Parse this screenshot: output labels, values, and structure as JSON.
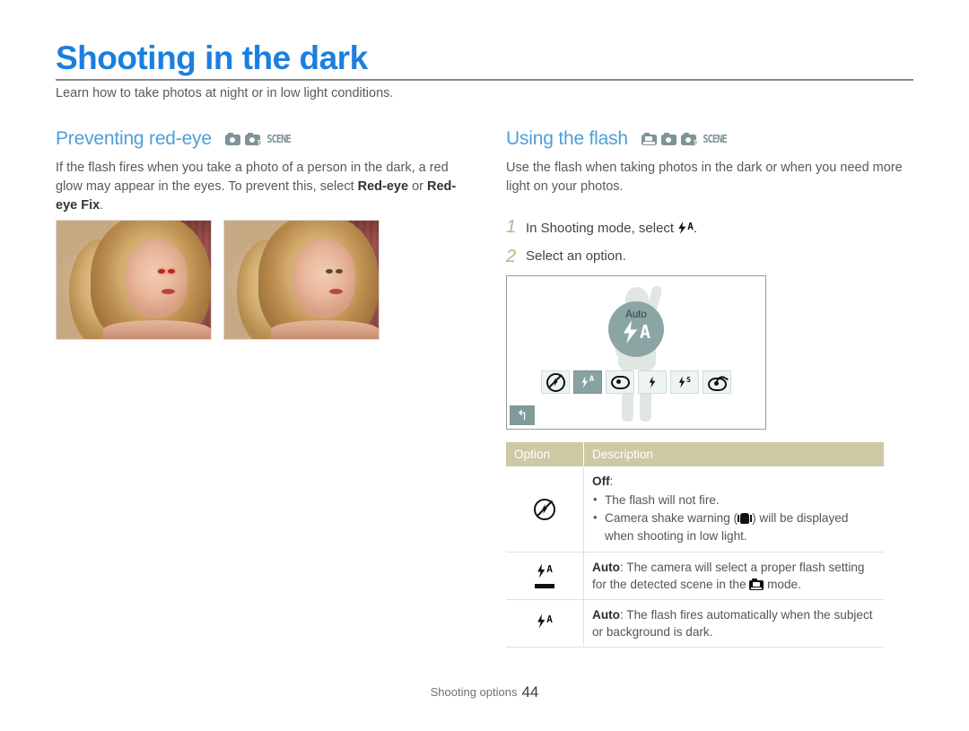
{
  "page": {
    "title": "Shooting in the dark",
    "subtitle": "Learn how to take photos at night or in low light conditions.",
    "footer_label": "Shooting options",
    "footer_page": "44",
    "accent_color": "#1b7fe0",
    "heading_color": "#4d9fd8",
    "rule_color": "#8e867c",
    "table_header_color": "#cdc9a5",
    "step_number_color": "#a9bd86"
  },
  "left_section": {
    "heading": "Preventing red-eye",
    "modes": [
      "camera-icon",
      "camera-program-icon",
      "SCENE"
    ],
    "paragraph_1": "If the flash fires when you take a photo of a person in the dark, a red glow may appear in the eyes. To prevent this, select ",
    "paragraph_bold_1": "Red-eye",
    "paragraph_2": " or ",
    "paragraph_bold_2": "Red-eye Fix",
    "paragraph_3": ".",
    "photos": [
      {
        "caption": "",
        "name": "photo-with-red-eye"
      },
      {
        "caption": "",
        "name": "photo-red-eye-corrected"
      }
    ]
  },
  "right_section": {
    "heading": "Using the flash",
    "modes": [
      "smart-auto-icon",
      "camera-icon",
      "camera-program-icon",
      "SCENE"
    ],
    "paragraph": "Use the flash when taking photos in the dark or when you need more light on your photos.",
    "steps": [
      {
        "num": "1",
        "text_before": "In Shooting mode, select ",
        "icon": "flash-auto-icon",
        "text_after": "."
      },
      {
        "num": "2",
        "text_before": "Select an option.",
        "icon": "",
        "text_after": ""
      }
    ],
    "screen": {
      "badge_label": "Auto",
      "badge_icon": "flash-auto-icon",
      "back_button": "↰",
      "options": [
        {
          "name": "flash-off-icon",
          "selected": false
        },
        {
          "name": "flash-auto-icon",
          "selected": true
        },
        {
          "name": "red-eye-icon",
          "selected": false
        },
        {
          "name": "fill-in-flash-icon",
          "selected": false
        },
        {
          "name": "slow-sync-icon",
          "selected": false
        },
        {
          "name": "red-eye-fix-icon",
          "selected": false
        }
      ]
    },
    "table": {
      "headers": [
        "Option",
        "Description"
      ],
      "rows": [
        {
          "icon": "flash-off-icon",
          "title": "Off",
          "colon": ":",
          "bullets": [
            {
              "before": "The flash will not fire.",
              "icon": "",
              "after": ""
            },
            {
              "before": "Camera shake warning (",
              "icon": "camera-shake-icon",
              "after": ") will be displayed when shooting in low light."
            }
          ]
        },
        {
          "icon": "smart-flash-auto-icon",
          "title": "Auto",
          "colon": ":",
          "text_before": " The camera will select a proper flash setting for the detected scene in the ",
          "inline_icon": "smart-auto-icon",
          "text_after": " mode."
        },
        {
          "icon": "flash-auto-icon",
          "title": "Auto",
          "colon": ":",
          "text_before": " The flash fires automatically when the subject or background is dark.",
          "inline_icon": "",
          "text_after": ""
        }
      ]
    }
  }
}
